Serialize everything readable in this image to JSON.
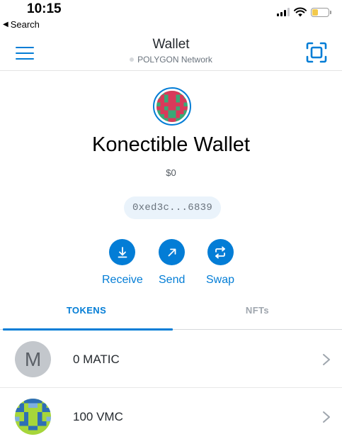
{
  "status_bar": {
    "time": "10:15",
    "back_label": "Search",
    "back_glyph": "◀"
  },
  "header": {
    "title": "Wallet",
    "network": "POLYGON Network"
  },
  "account": {
    "name": "Konectible Wallet",
    "balance": "$0",
    "address": "0xed3c...6839"
  },
  "actions": [
    {
      "label": "Receive",
      "icon": "download-icon"
    },
    {
      "label": "Send",
      "icon": "arrow-up-right-icon"
    },
    {
      "label": "Swap",
      "icon": "swap-icon"
    }
  ],
  "tabs": [
    {
      "label": "TOKENS",
      "active": true
    },
    {
      "label": "NFTs",
      "active": false
    }
  ],
  "tokens": [
    {
      "icon_letter": "M",
      "amount": "0 MATIC"
    },
    {
      "icon_letter": "",
      "amount": "100 VMC"
    }
  ],
  "colors": {
    "accent": "#037dd6",
    "battery": "#f2c94c",
    "avatar_red": "#d93a5a",
    "avatar_green": "#3aa876",
    "vmc_green": "#a6d63a",
    "vmc_blue": "#2f6fb5"
  }
}
